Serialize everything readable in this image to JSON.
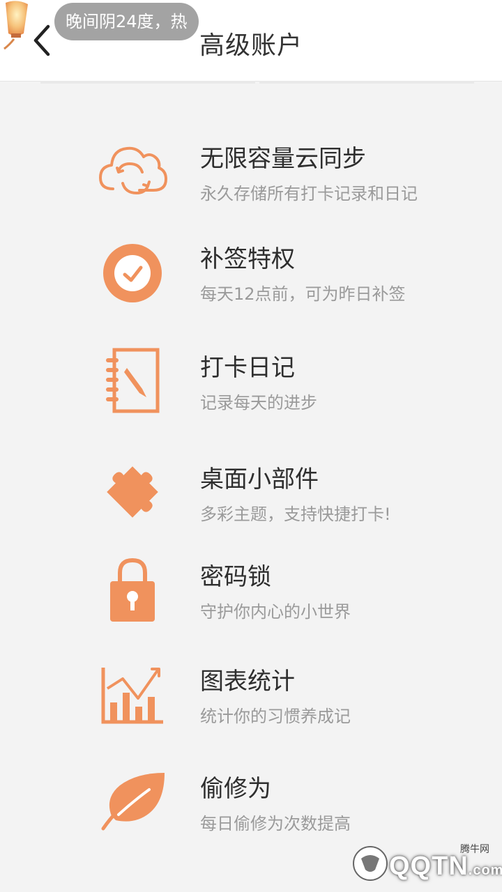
{
  "header": {
    "title": "高级账户",
    "back_icon": "chevron-left-icon"
  },
  "toast": {
    "text": "晚间阴24度，热"
  },
  "accent_color": "#f0925d",
  "features": [
    {
      "icon": "cloud-sync-icon",
      "title": "无限容量云同步",
      "desc": "永久存储所有打卡记录和日记"
    },
    {
      "icon": "clock-check-icon",
      "title": "补签特权",
      "desc": "每天12点前，可为昨日补签"
    },
    {
      "icon": "notebook-pen-icon",
      "title": "打卡日记",
      "desc": "记录每天的进步"
    },
    {
      "icon": "puzzle-icon",
      "title": "桌面小部件",
      "desc": "多彩主题，支持快捷打卡!"
    },
    {
      "icon": "lock-icon",
      "title": "密码锁",
      "desc": "守护你内心的小世界"
    },
    {
      "icon": "chart-icon",
      "title": "图表统计",
      "desc": "统计你的习惯养成记"
    },
    {
      "icon": "leaf-icon",
      "title": "偷修为",
      "desc": "每日偷修为次数提高"
    }
  ],
  "watermark": {
    "text": "QQTN",
    "suffix": ".com",
    "site": "腾牛网"
  }
}
